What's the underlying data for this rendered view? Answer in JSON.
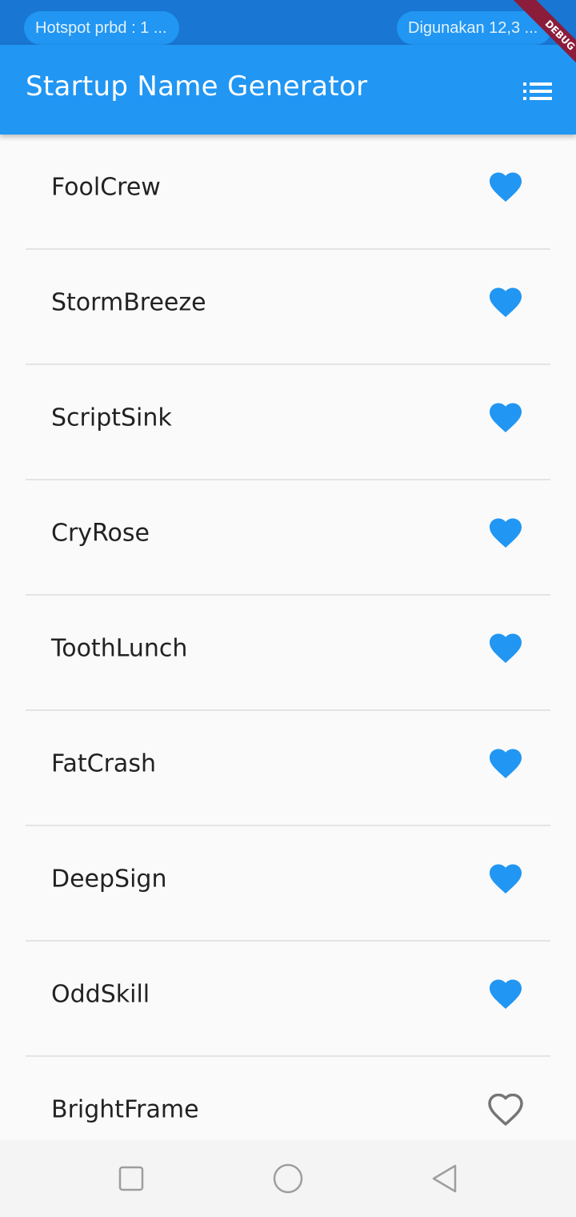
{
  "status_bar": {
    "left_pill": "Hotspot prbd : 1 ...",
    "right_pill": "Digunakan 12,3 ..."
  },
  "debug_banner": "DEBUG",
  "app_bar": {
    "title": "Startup Name Generator",
    "action_icon": "list-icon"
  },
  "colors": {
    "primary": "#2196f3",
    "status_bar": "#1976d2",
    "heart_saved": "#2196f3",
    "heart_unsaved": "#757575"
  },
  "list": {
    "items": [
      {
        "label": "FoolCrew",
        "saved": true
      },
      {
        "label": "StormBreeze",
        "saved": true
      },
      {
        "label": "ScriptSink",
        "saved": true
      },
      {
        "label": "CryRose",
        "saved": true
      },
      {
        "label": "ToothLunch",
        "saved": true
      },
      {
        "label": "FatCrash",
        "saved": true
      },
      {
        "label": "DeepSign",
        "saved": true
      },
      {
        "label": "OddSkill",
        "saved": true
      },
      {
        "label": "BrightFrame",
        "saved": false
      }
    ]
  },
  "nav_bar": {
    "icons": [
      "recent-apps-icon",
      "home-icon",
      "back-icon"
    ]
  }
}
